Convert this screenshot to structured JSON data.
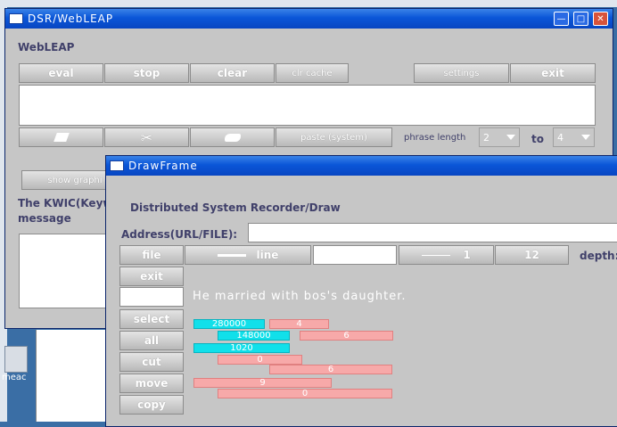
{
  "desktop": {
    "icon_label": "meac"
  },
  "webleap": {
    "title": "DSR/WebLEAP",
    "heading": "WebLEAP",
    "buttons": {
      "eval": "eval",
      "stop": "stop",
      "clear": "clear",
      "clr_cache": "clr cache",
      "settings": "settings",
      "exit": "exit"
    },
    "paste_label": "paste (system)",
    "phrase_length_label": "phrase length",
    "phrase_from": "2",
    "to_label": "to",
    "phrase_to": "4",
    "show_graphics": "show graphi",
    "kwic_label": "The KWIC(Keywo",
    "message_label": "message"
  },
  "drawframe": {
    "title": "DrawFrame",
    "heading": "Distributed System Recorder/Draw",
    "address_label": "Address(URL/FILE):",
    "address_value": "",
    "toolbar": {
      "file": "file",
      "line_label": "line",
      "line_width": "1",
      "size": "12",
      "depth_label": "depth:"
    },
    "side_buttons": [
      "exit",
      "select",
      "all",
      "cut",
      "move",
      "copy"
    ],
    "canvas_text": "He married with bos's daughter.",
    "bars": [
      {
        "label": "280000",
        "color": "cyan"
      },
      {
        "label": "4",
        "color": "pink"
      },
      {
        "label": "148000",
        "color": "cyan"
      },
      {
        "label": "6",
        "color": "pink"
      },
      {
        "label": "1020",
        "color": "cyan"
      },
      {
        "label": "0",
        "color": "pink"
      },
      {
        "label": "6",
        "color": "pink"
      },
      {
        "label": "9",
        "color": "pink"
      },
      {
        "label": "0",
        "color": "pink"
      }
    ]
  }
}
